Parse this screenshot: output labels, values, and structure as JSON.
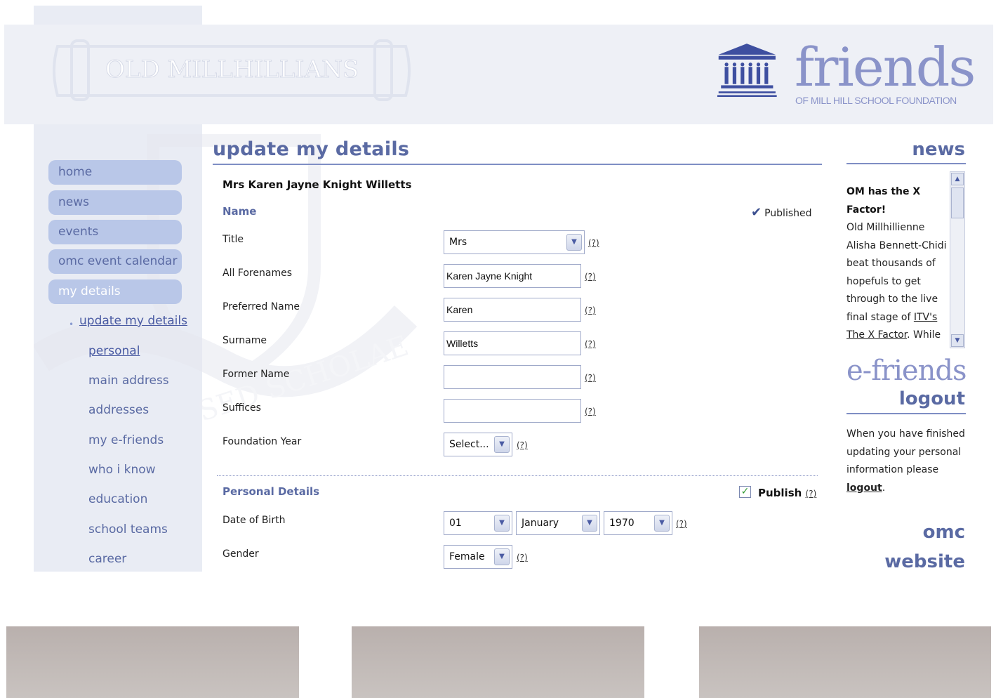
{
  "header": {
    "banner_text": "OLD MILLHILLIANS",
    "logo_word": "friends",
    "logo_sub": "OF MILL HILL SCHOOL FOUNDATION"
  },
  "nav": {
    "items": [
      {
        "label": "home"
      },
      {
        "label": "news"
      },
      {
        "label": "events"
      },
      {
        "label": "omc event calendar"
      },
      {
        "label": "my details"
      }
    ],
    "sub_items": [
      {
        "label": "update my details"
      },
      {
        "label": "personal"
      },
      {
        "label": "main address"
      },
      {
        "label": "addresses"
      },
      {
        "label": "my e-friends"
      },
      {
        "label": "who i know"
      },
      {
        "label": "education"
      },
      {
        "label": "school teams"
      },
      {
        "label": "career"
      }
    ]
  },
  "main": {
    "title": "update my details",
    "person": "Mrs Karen Jayne Knight Willetts",
    "name_section": {
      "label": "Name",
      "published": "Published"
    },
    "fields": {
      "title_label": "Title",
      "title_value": "Mrs",
      "forenames_label": "All Forenames",
      "forenames_value": "Karen Jayne Knight",
      "preferred_label": "Preferred Name",
      "preferred_value": "Karen",
      "surname_label": "Surname",
      "surname_value": "Willetts",
      "former_label": "Former Name",
      "former_value": "",
      "suffices_label": "Suffices",
      "suffices_value": "",
      "foundation_label": "Foundation Year",
      "foundation_value": "Select..."
    },
    "personal_section": {
      "label": "Personal Details",
      "publish_label": "Publish",
      "publish_checked": true
    },
    "dob": {
      "label": "Date of Birth",
      "day": "01",
      "month": "January",
      "year": "1970"
    },
    "gender": {
      "label": "Gender",
      "value": "Female"
    },
    "help_text": "(?)"
  },
  "right": {
    "news_heading": "news",
    "news_title_1": "OM",
    "news_title_2": "has the",
    "news_title_3": "X",
    "news_title_4": "Factor!",
    "news_body_1": "Old Millhillienne Alisha Bennett-Chidi beat thousands of hopefuls to get through to the live final stage of",
    "news_link_1": "ITV's The X Factor",
    "news_body_2": ". While",
    "efriends": "e-friends",
    "logout_heading": "logout",
    "logout_text": "When you have finished updating your personal information please",
    "logout_link": "logout",
    "logout_end": ".",
    "omc_1": "omc",
    "omc_2": "website"
  },
  "colors": {
    "accent": "#5a6aa3",
    "nav_bg": "#b9c7e8",
    "logo": "#8a93c9"
  }
}
